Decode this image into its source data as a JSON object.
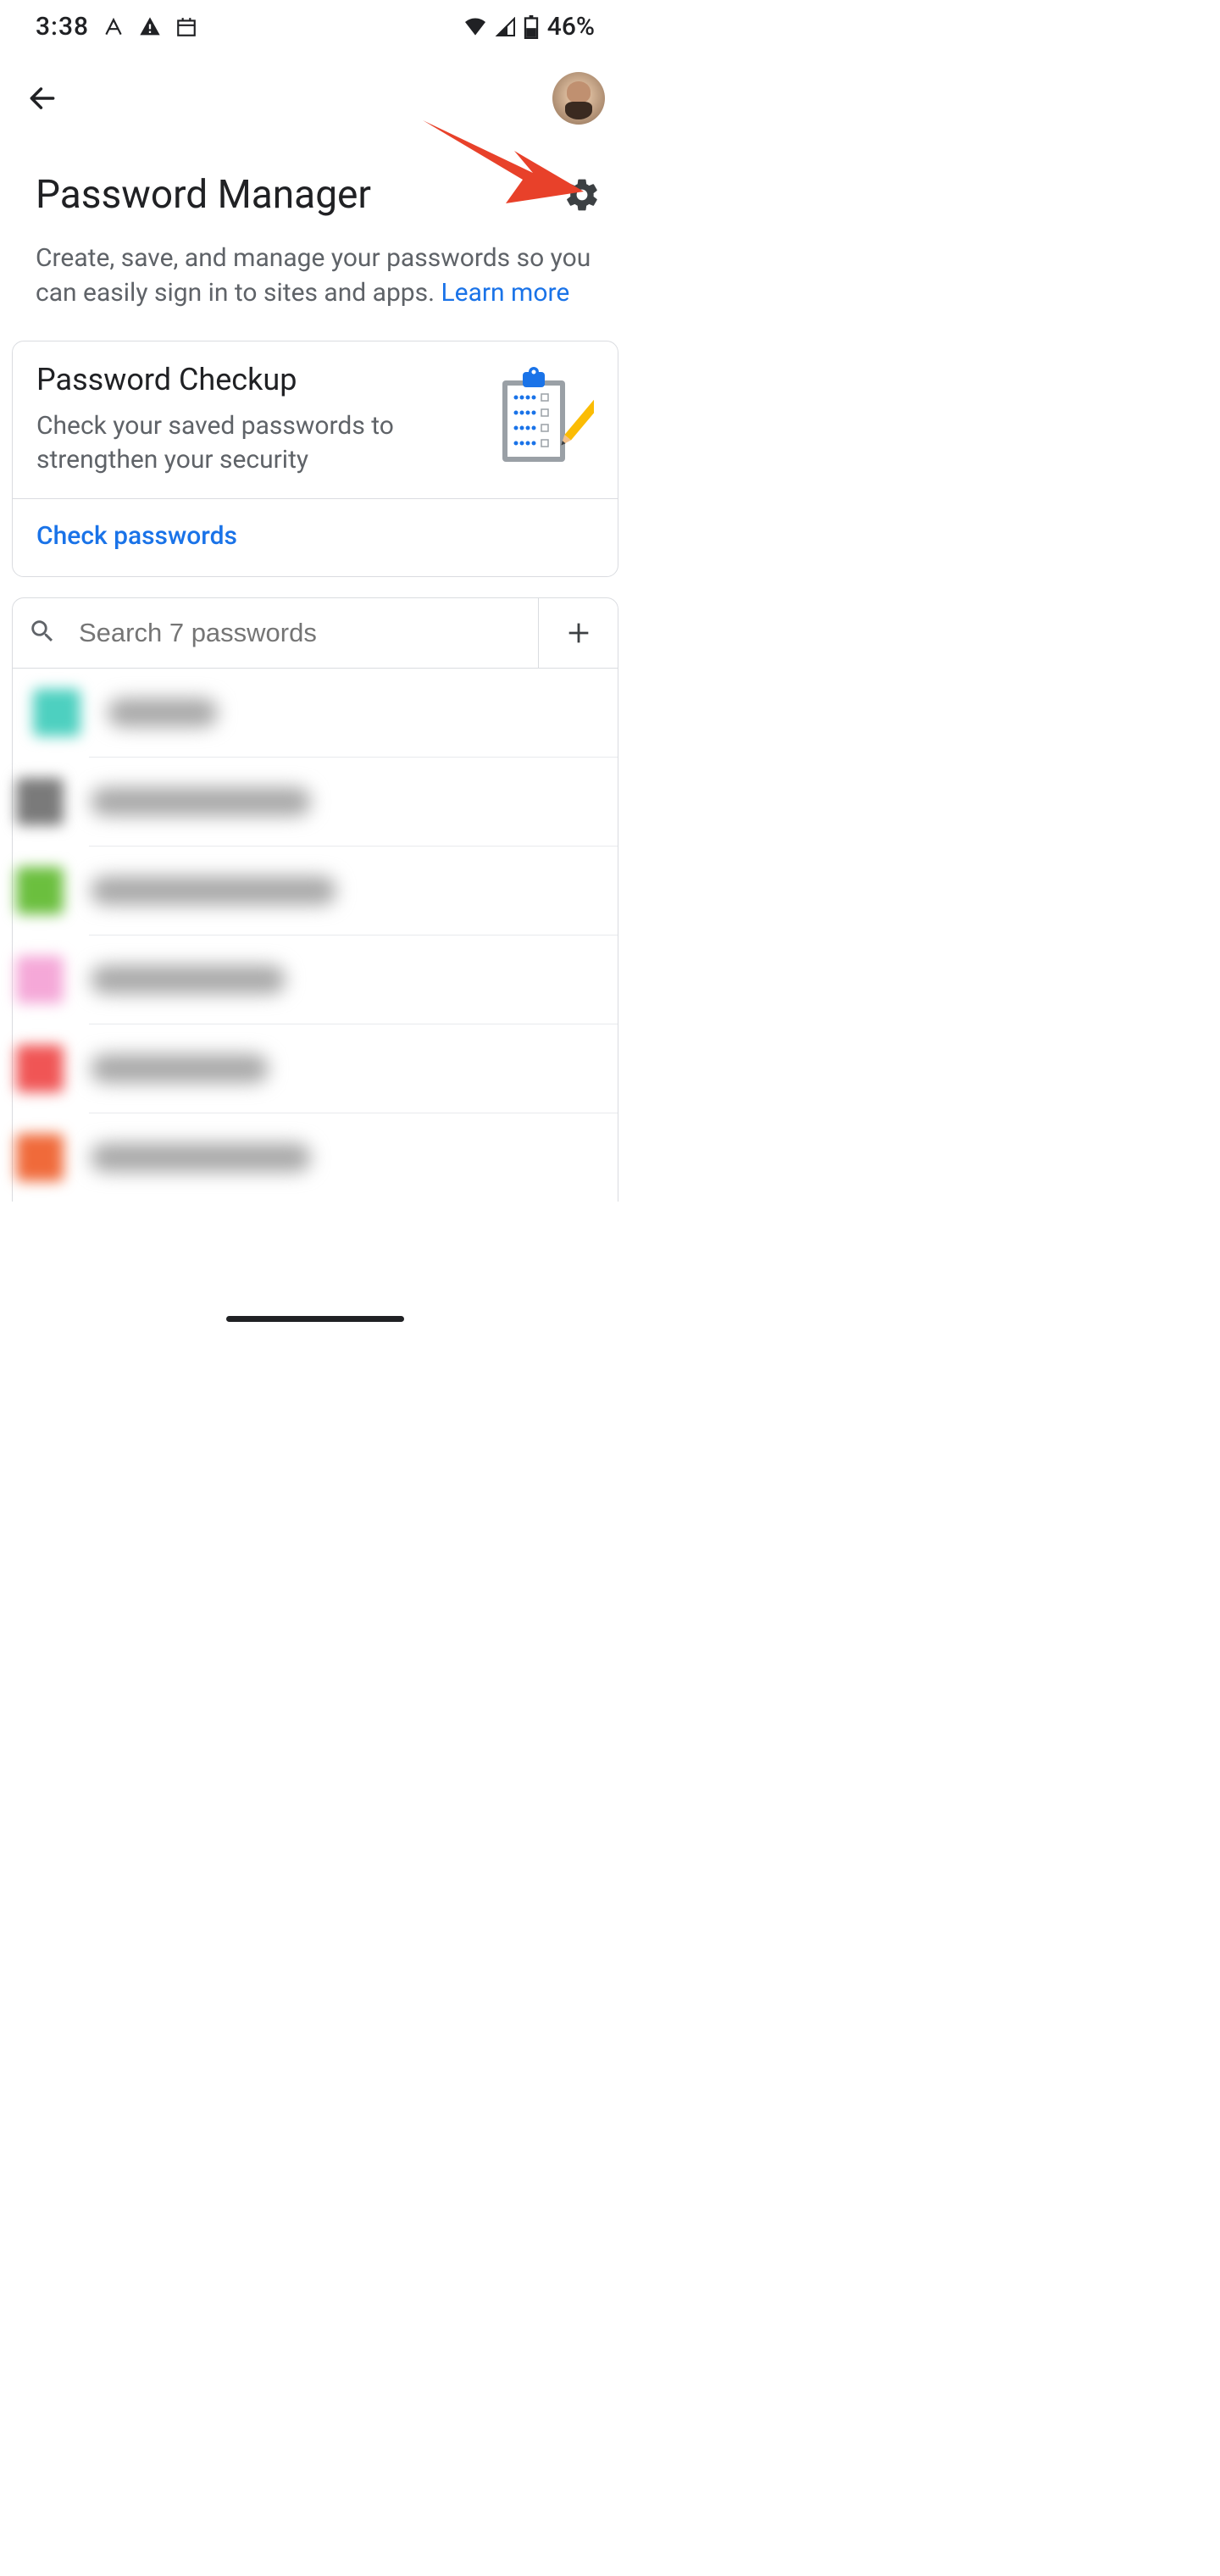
{
  "status": {
    "time": "3:38",
    "battery_pct": "46%"
  },
  "header": {
    "title": "Password Manager",
    "desc_prefix": "Create, save, and manage your passwords so you can easily sign in to sites and apps. ",
    "learn_more": "Learn more"
  },
  "checkup": {
    "title": "Password Checkup",
    "subtitle": "Check your saved passwords to strengthen your security",
    "action": "Check passwords"
  },
  "search": {
    "placeholder": "Search 7 passwords"
  },
  "passwords": [
    {
      "icon_color": "#4dd0c0",
      "label_width": 130
    },
    {
      "icon_color": "#7a7a7a",
      "label_width": 260
    },
    {
      "icon_color": "#6bbf3e",
      "label_width": 290
    },
    {
      "icon_color": "#f5a8d8",
      "label_width": 230
    },
    {
      "icon_color": "#f05555",
      "label_width": 210
    },
    {
      "icon_color": "#f06a3a",
      "label_width": 260
    }
  ]
}
